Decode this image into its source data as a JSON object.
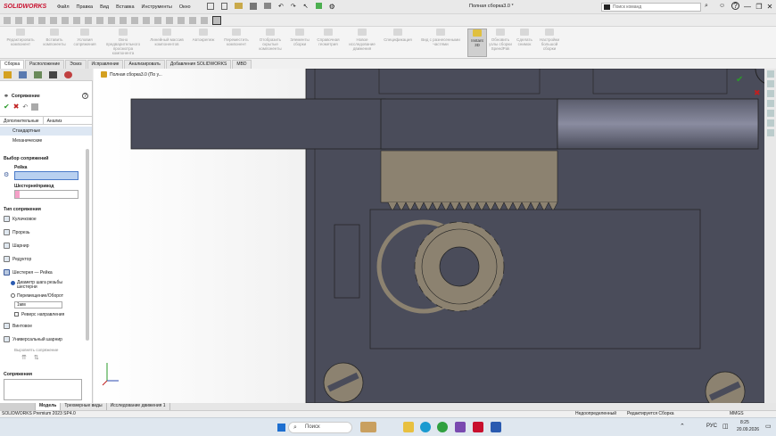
{
  "app": {
    "logo": "SOLIDWORKS",
    "doc_title": "Полная сборка3.0 *",
    "search_placeholder": "Поиск команд"
  },
  "menu": [
    "Файл",
    "Правка",
    "Вид",
    "Вставка",
    "Инструменты",
    "Окно"
  ],
  "window_controls": {
    "minimize": "—",
    "restore": "❐",
    "close": "✕",
    "help": "?"
  },
  "commands": [
    {
      "label": "Редактировать компонент"
    },
    {
      "label": "Вставить компоненты"
    },
    {
      "label": "Условия сопряжения"
    },
    {
      "label": "Окно предварительного просмотра компонента"
    },
    {
      "label": "Линейный массив компонентов"
    },
    {
      "label": "Автокрепеж"
    },
    {
      "label": "Переместить компонент"
    },
    {
      "label": "Отобразить скрытые компоненты"
    },
    {
      "label": "Элементы сборки"
    },
    {
      "label": "Справочная геометрия"
    },
    {
      "label": "Новое исследование движения"
    },
    {
      "label": "Спецификация"
    },
    {
      "label": "Вид с разнесенными частями"
    },
    {
      "label": "Instant 3D"
    },
    {
      "label": "Обновить узлы сборки SpeedPak"
    },
    {
      "label": "Сделать снимок"
    },
    {
      "label": "Настройки большой сборки"
    }
  ],
  "tabs": [
    "Сборка",
    "Расположение",
    "Эскиз",
    "Исправление",
    "Анализировать",
    "Добавления SOLIDWORKS",
    "MBD"
  ],
  "tree_root": "Полная сборка3.0 (По у...",
  "property_manager": {
    "title": "Сопряжение",
    "help": "?",
    "ok": "✔",
    "cancel": "✖",
    "subtabs": [
      "Дополнительные",
      "Анализ"
    ],
    "standard": "Стандартные",
    "mechanical": "Механические",
    "selection_title": "Выбор сопряжений",
    "rack_label": "Рейка",
    "gear_label": "Шестерня/привод",
    "mate_type_title": "Тип сопряжения",
    "mate_types": [
      "Кулачковое",
      "Прорезь",
      "Шарнир",
      "Редуктор",
      "Шестерня — Рейка"
    ],
    "opt_diameter": "Диаметр шага резьбы шестерни",
    "opt_travel": "Перемещение/Оборот",
    "value": "1мм",
    "reverse": "Реверс направления",
    "more_types": [
      "Винтовое",
      "Универсальный шарнир"
    ],
    "align_label": "Выровнять сопряжение",
    "mates_title": "Сопряжения"
  },
  "bottom_tabs": [
    "Модель",
    "Трехмерные виды",
    "Исследование движения 1"
  ],
  "status": {
    "left": "SOLIDWORKS Premium 2023 SP4.0",
    "defined": "Недоопределенный",
    "editing": "Редактируется Сборка",
    "units": "MMGS"
  },
  "taskbar": {
    "search": "Поиск",
    "lang": "РУС",
    "time": "8:25",
    "date": "20.09.2026"
  },
  "colors": {
    "accent": "#c8102e",
    "dark_part": "#4a4c5a",
    "gear": "#8c8270",
    "selection_blue": "#b8d0f0",
    "selection_pink": "#f5a0c8"
  }
}
